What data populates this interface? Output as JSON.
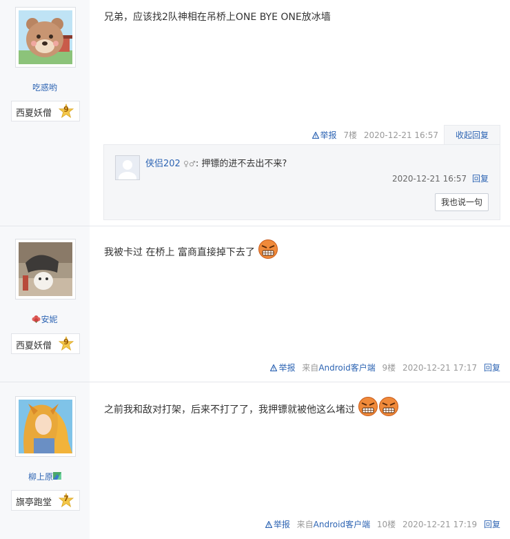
{
  "posts": [
    {
      "username": "吃惑哟",
      "rank_title": "西夏妖僧",
      "rank_level": "9",
      "content": "兄弟，应该找2队神相在吊桥上ONE BYE ONE放冰墙",
      "report": "举报",
      "client": "",
      "floor": "7楼",
      "time": "2020-12-21 16:57",
      "action": "收起回复",
      "reply": {
        "user": "侠侣202",
        "gender": "♀♂",
        "text": ": 押镖的进不去出不来?",
        "time": "2020-12-21 16:57",
        "reply_label": "回复",
        "say_button": "我也说一句"
      }
    },
    {
      "username": "安妮",
      "rank_title": "西夏妖僧",
      "rank_level": "9",
      "content": "我被卡过 在桥上 富商直接掉下去了",
      "report": "举报",
      "client": "来自Android客户端",
      "floor": "9楼",
      "time": "2020-12-21 17:17",
      "action": "回复"
    },
    {
      "username": "柳上原",
      "rank_title": "旗亭跑堂",
      "rank_level": "7",
      "content": "之前我和敌对打架，后来不打了了，我押镖就被他这么堵过",
      "report": "举报",
      "client": "来自Android客户端",
      "floor": "10楼",
      "time": "2020-12-21 17:19",
      "action": "回复"
    }
  ],
  "colors": {
    "link": "#2d64b3",
    "sidebar": "#f7f8fa",
    "meta": "#999999",
    "level_star": "#f3c74a"
  },
  "icons": [
    "avatar-bear",
    "avatar-cat",
    "avatar-anime",
    "level-star-icon",
    "report-icon",
    "angry-face-icon",
    "flower-icon",
    "landscape-icon",
    "default-avatar-icon"
  ]
}
